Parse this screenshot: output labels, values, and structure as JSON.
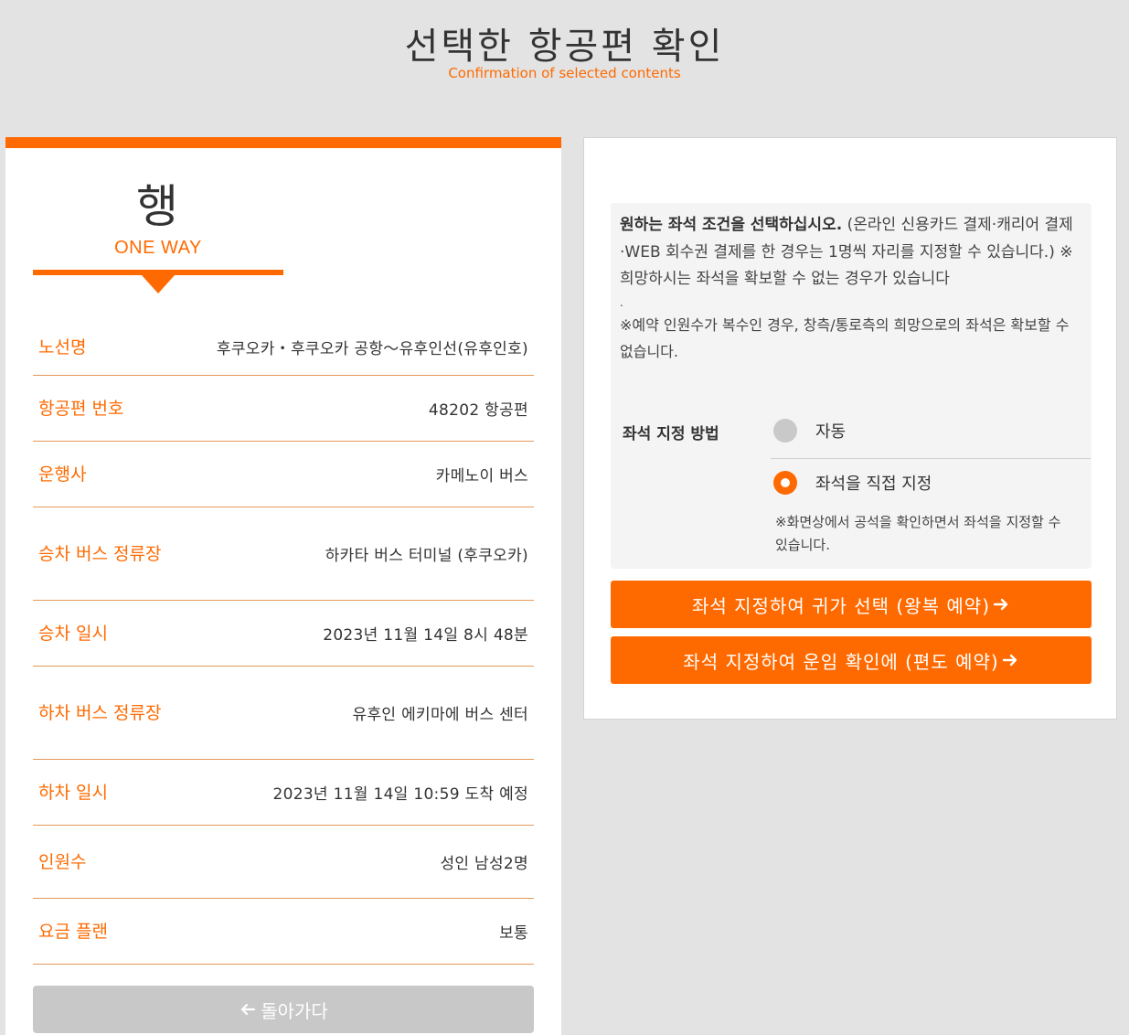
{
  "header": {
    "title": "선택한 항공편 확인",
    "subtitle": "Confirmation of selected contents"
  },
  "trip": {
    "way_kor": "행",
    "way_eng": "ONE WAY"
  },
  "details": [
    {
      "label": "노선명",
      "value": "후쿠오카・후쿠오카 공항～유후인선(유후인호)"
    },
    {
      "label": "항공편 번호",
      "value": "48202 항공편"
    },
    {
      "label": "운행사",
      "value": "카메노이 버스"
    },
    {
      "label": "승차 버스 정류장",
      "value": "하카타 버스 터미널 (후쿠오카)"
    },
    {
      "label": "승차 일시",
      "value": "2023년 11월 14일 8시 48분"
    },
    {
      "label": "하차 버스 정류장",
      "value": "유후인 에키마에 버스 센터"
    },
    {
      "label": "하차 일시",
      "value": "2023년 11월 14일 10:59 도착 예정"
    },
    {
      "label": "인원수",
      "value": "성인 남성2명"
    },
    {
      "label": "요금 플랜",
      "value": "보통"
    }
  ],
  "back_button": "돌아가다",
  "notice": {
    "bold": "원하는 좌석 조건을 선택하십시오.",
    "text": " (온라인 신용카드 결제·캐리어 결제·WEB 회수권 결제를 한 경우는 1명씩 자리를 지정할 수 있습니다.) ※희망하시는 좌석을 확보할 수 없는 경우가 있습니다",
    "dot": ".",
    "text2": "※예약 인원수가 복수인 경우, 창측/통로측의 희망으로의 좌석은 확보할 수 없습니다."
  },
  "seat": {
    "label": "좌석 지정 방법",
    "options": [
      {
        "label": "자동",
        "selected": false
      },
      {
        "label": "좌석을 직접 지정",
        "selected": true
      }
    ],
    "note": "※화면상에서 공석을 확인하면서 좌석을 지정할 수 있습니다."
  },
  "actions": {
    "round_trip": "좌석 지정하여 귀가 선택 (왕복 예약)",
    "one_way": "좌석 지정하여 운임 확인에 (편도 예약)"
  },
  "colors": {
    "accent": "#ff6a00",
    "background": "#e3e3e3",
    "back_button": "#c8c8c8"
  }
}
